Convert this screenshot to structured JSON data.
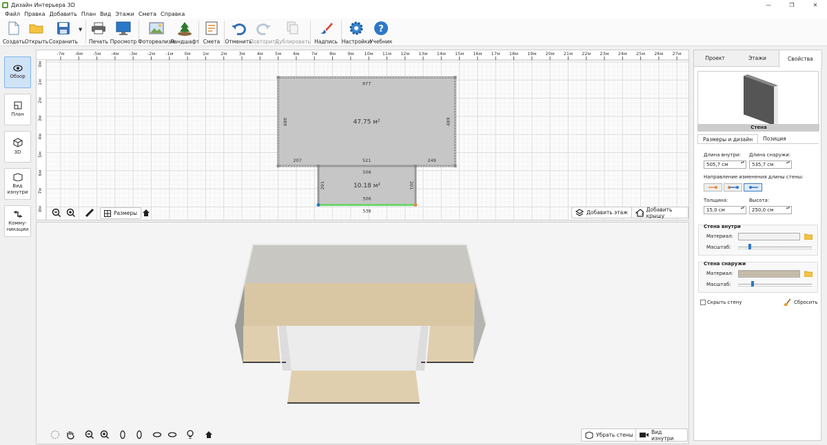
{
  "window": {
    "title": "Дизайн Интерьера 3D"
  },
  "menu": [
    "Файл",
    "Правка",
    "Добавить",
    "План",
    "Вид",
    "Этажи",
    "Смета",
    "Справка"
  ],
  "toolbar": {
    "create": "Создать",
    "open": "Открыть",
    "save": "Сохранить",
    "print": "Печать",
    "preview": "Просмотр",
    "photoreal": "Фотореализм",
    "landscape": "Ландшафт",
    "estimate": "Смета",
    "undo": "Отменить",
    "redo": "Повторить",
    "duplicate": "Дублировать",
    "label": "Надпись",
    "settings": "Настройки",
    "tutorial": "Учебник"
  },
  "leftbar": {
    "overview": "Обзор",
    "plan": "План",
    "view3d": "3D",
    "inside_view": "Вид изнутри",
    "communications": "Комму-никации"
  },
  "plan": {
    "ruler_top": [
      "-7м",
      "-6м",
      "-5м",
      "-4м",
      "-3м",
      "-2м",
      "-1м",
      "0м",
      "1м",
      "2м",
      "3м",
      "4м",
      "5м",
      "6м",
      "7м",
      "8м",
      "9м",
      "10м",
      "11м",
      "12м",
      "13м",
      "14м",
      "15м",
      "16м",
      "17м",
      "18м",
      "19м",
      "20м",
      "21м",
      "22м",
      "23м",
      "24м",
      "25м",
      "26м",
      "27м"
    ],
    "ruler_left": [
      "0м",
      "1м",
      "2м",
      "3м",
      "4м",
      "5м",
      "6м",
      "7м",
      "8м"
    ],
    "room1": {
      "area": "47.75 м²",
      "top": "977",
      "left": "489",
      "right": "489",
      "bottom_left": "207",
      "bottom_mid": "521",
      "bottom_right": "249"
    },
    "room2": {
      "area": "10.18 м²",
      "top": "506",
      "left": "201",
      "right": "201",
      "bottom_inner": "506",
      "bottom_outer": "536"
    },
    "dimensions_btn": "Размеры",
    "add_floor_btn": "Добавить этаж",
    "add_roof_btn": "Добавить крышу"
  },
  "view3d": {
    "remove_walls_btn": "Убрать стены",
    "inside_view_btn": "Вид изнутри"
  },
  "panel": {
    "tabs": [
      "Проект",
      "Этажи",
      "Свойства"
    ],
    "active_tab": "Свойства",
    "preview_label": "Стена",
    "subtabs": [
      "Размеры и дизайн",
      "Позиция"
    ],
    "length_inside_label": "Длина внутри:",
    "length_inside": "505,7 см",
    "length_outside_label": "Длина снаружи:",
    "length_outside": "535,7 см",
    "direction_label": "Направление изменения длины стены:",
    "thickness_label": "Толщина:",
    "thickness": "15,0 см",
    "height_label": "Высота:",
    "height": "250,0 см",
    "wall_inside_title": "Стена внутри",
    "material_label": "Материал:",
    "scale_label": "Масштаб:",
    "wall_outside_title": "Стена снаружи",
    "inside_scale_level": 0.14,
    "outside_scale_level": 0.18,
    "hide_wall_label": "Скрыть стену",
    "reset_label": "Сбросить"
  },
  "colors": {
    "accent": "#2b78c6",
    "active_btn": "#cfe3f6",
    "room_fill": "#c8c8c8",
    "wall_selected": "#6fd66f"
  }
}
